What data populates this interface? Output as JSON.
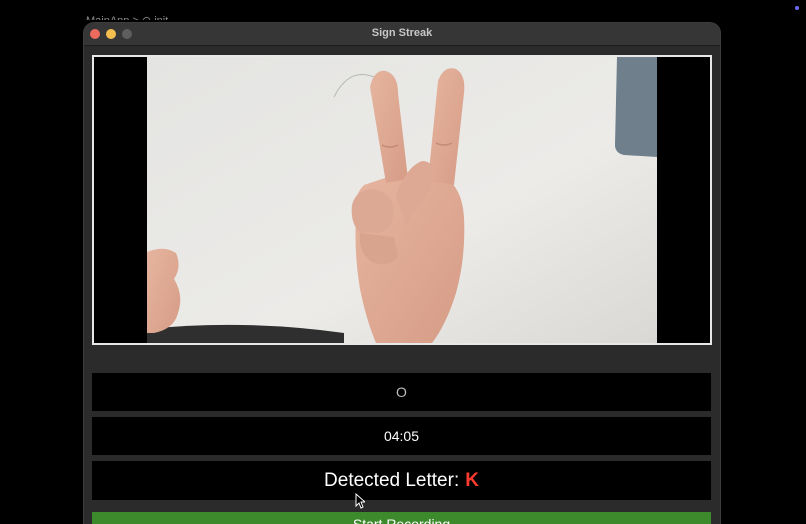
{
  "background": {
    "editor_text": "MainApp  >  ⊙  init"
  },
  "window": {
    "title": "Sign Streak"
  },
  "camera_feed": {
    "description_icon": "camera-feed"
  },
  "target_letter": "O",
  "timer": "04:05",
  "detected": {
    "label": "Detected Letter:",
    "value": "K",
    "value_color": "#ff3b30"
  },
  "record_button": {
    "label": "Start Recording",
    "color": "#3c8a2c"
  },
  "colors": {
    "window_bg": "#2b2b2b",
    "panel_bg": "#000000",
    "close": "#ed6a5e",
    "minimize": "#f4bf4f",
    "zoom_disabled": "#5e5e5e"
  }
}
